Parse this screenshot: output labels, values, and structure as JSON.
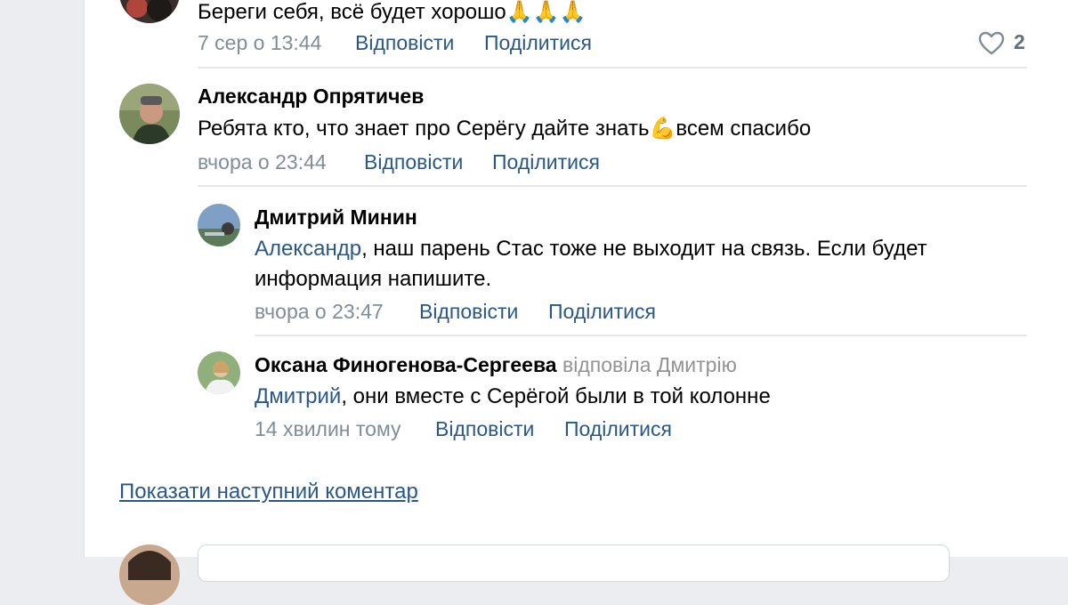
{
  "comments": [
    {
      "text": "Береги себя, всё будет хорошо",
      "emoji": "🙏🙏🙏",
      "time": "7 сер о 13:44",
      "reply": "Відповісти",
      "share": "Поділитися",
      "likes": "2"
    },
    {
      "author": "Александр Опрятичев",
      "text_before": "Ребята кто, что знает про Серёгу дайте знать",
      "emoji": "💪",
      "text_after": "всем спасибо",
      "time": "вчора о 23:44",
      "reply": "Відповісти",
      "share": "Поділитися"
    },
    {
      "author": "Дмитрий Минин",
      "mention": "Александр",
      "line1": ", наш парень Стас тоже не выходит на связь. Если будет",
      "line2": "информация напишите.",
      "time": "вчора о 23:47",
      "reply": "Відповісти",
      "share": "Поділитися"
    },
    {
      "author": "Оксана Финогенова-Сергеева",
      "replied_to": "відповіла Дмитрію",
      "mention": "Дмитрий",
      "text": ", они вместе с Серёгой были в той колонне",
      "time": "14 хвилин тому",
      "reply": "Відповісти",
      "share": "Поділитися"
    }
  ],
  "show_next": "Показати наступний коментар",
  "colors": {
    "link": "#2a5885",
    "meta": "#818c99",
    "separator": "#e7e8ec",
    "page_bg": "#ebedf0"
  },
  "icons": [
    "heart-icon"
  ]
}
